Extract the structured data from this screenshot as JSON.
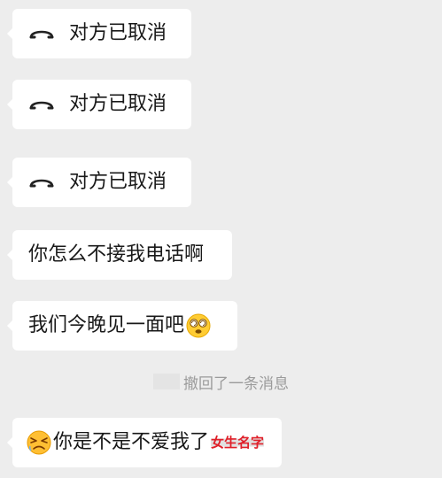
{
  "messages": [
    {
      "type": "call",
      "text": "对方已取消",
      "icon": "hangup-phone-icon"
    },
    {
      "type": "call",
      "text": "对方已取消",
      "icon": "hangup-phone-icon"
    },
    {
      "type": "call",
      "text": "对方已取消",
      "icon": "hangup-phone-icon"
    },
    {
      "type": "text",
      "text": "你怎么不接我电话啊"
    },
    {
      "type": "text",
      "text": "我们今晚见一面吧",
      "emoji": "dizzy-face-emoji"
    },
    {
      "type": "text",
      "text": "你是不是不爱我了",
      "emoji": "angry-face-emoji",
      "name_tag": "女生名字"
    }
  ],
  "recall_notice": "撤回了一条消息",
  "colors": {
    "background": "#ededed",
    "bubble": "#ffffff",
    "text": "#191919",
    "notice_text": "#9b9b9b",
    "name_tag": "#e0202a"
  }
}
